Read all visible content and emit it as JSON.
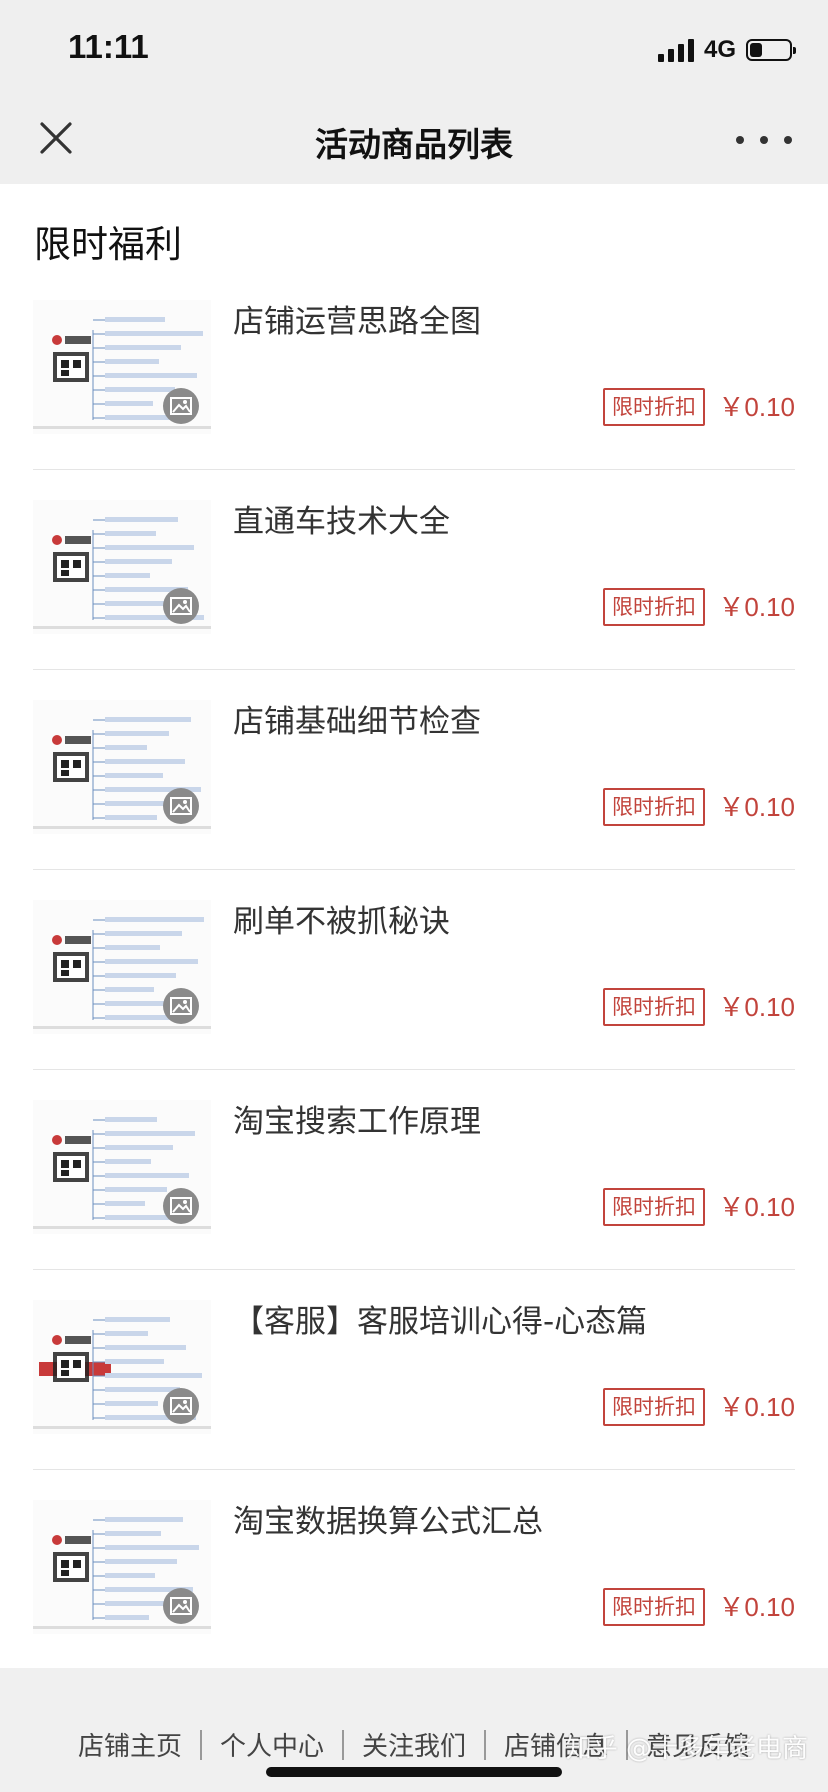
{
  "status": {
    "time": "11:11",
    "network": "4G"
  },
  "nav": {
    "title": "活动商品列表"
  },
  "section": {
    "title": "限时福利"
  },
  "items": [
    {
      "title": "店铺运营思路全图",
      "tag": "限时折扣",
      "price": "￥0.10"
    },
    {
      "title": "直通车技术大全",
      "tag": "限时折扣",
      "price": "￥0.10"
    },
    {
      "title": "店铺基础细节检查",
      "tag": "限时折扣",
      "price": "￥0.10"
    },
    {
      "title": "刷单不被抓秘诀",
      "tag": "限时折扣",
      "price": "￥0.10"
    },
    {
      "title": "淘宝搜索工作原理",
      "tag": "限时折扣",
      "price": "￥0.10"
    },
    {
      "title": "【客服】客服培训心得-心态篇",
      "tag": "限时折扣",
      "price": "￥0.10"
    },
    {
      "title": "淘宝数据换算公式汇总",
      "tag": "限时折扣",
      "price": "￥0.10"
    }
  ],
  "footer": {
    "links": [
      "店铺主页",
      "个人中心",
      "关注我们",
      "店铺信息",
      "意见反馈"
    ]
  },
  "watermark": "知乎 @十多年老电商",
  "colors": {
    "accent": "#c2443c",
    "bar_bg": "#efefef"
  }
}
